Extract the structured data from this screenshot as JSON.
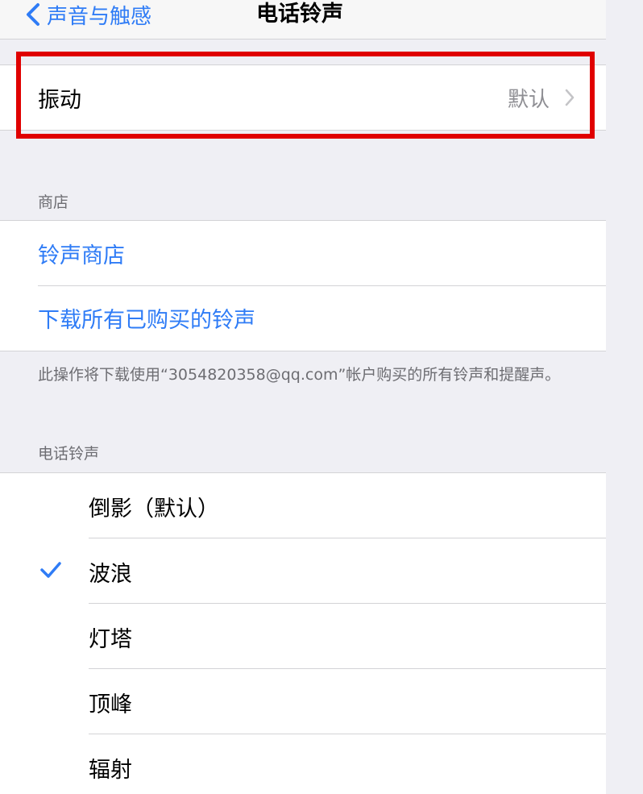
{
  "nav": {
    "back_label": "声音与触感",
    "title": "电话铃声"
  },
  "vibration": {
    "label": "振动",
    "value": "默认"
  },
  "store": {
    "header": "商店",
    "items": [
      {
        "label": "铃声商店"
      },
      {
        "label": "下载所有已购买的铃声"
      }
    ],
    "footer": "此操作将下载使用“3054820358@qq.com”帐户购买的所有铃声和提醒声。"
  },
  "ringtones": {
    "header": "电话铃声",
    "items": [
      {
        "label": "倒影（默认）",
        "selected": false
      },
      {
        "label": "波浪",
        "selected": true
      },
      {
        "label": "灯塔",
        "selected": false
      },
      {
        "label": "顶峰",
        "selected": false
      },
      {
        "label": "辐射",
        "selected": false
      }
    ]
  },
  "colors": {
    "accent": "#2f7cf6",
    "highlight": "#e00000",
    "background": "#efeff4",
    "secondary_text": "#8e8e93"
  },
  "icons": {
    "back": "chevron-left-icon",
    "disclosure": "chevron-right-icon",
    "selected": "checkmark-icon"
  }
}
